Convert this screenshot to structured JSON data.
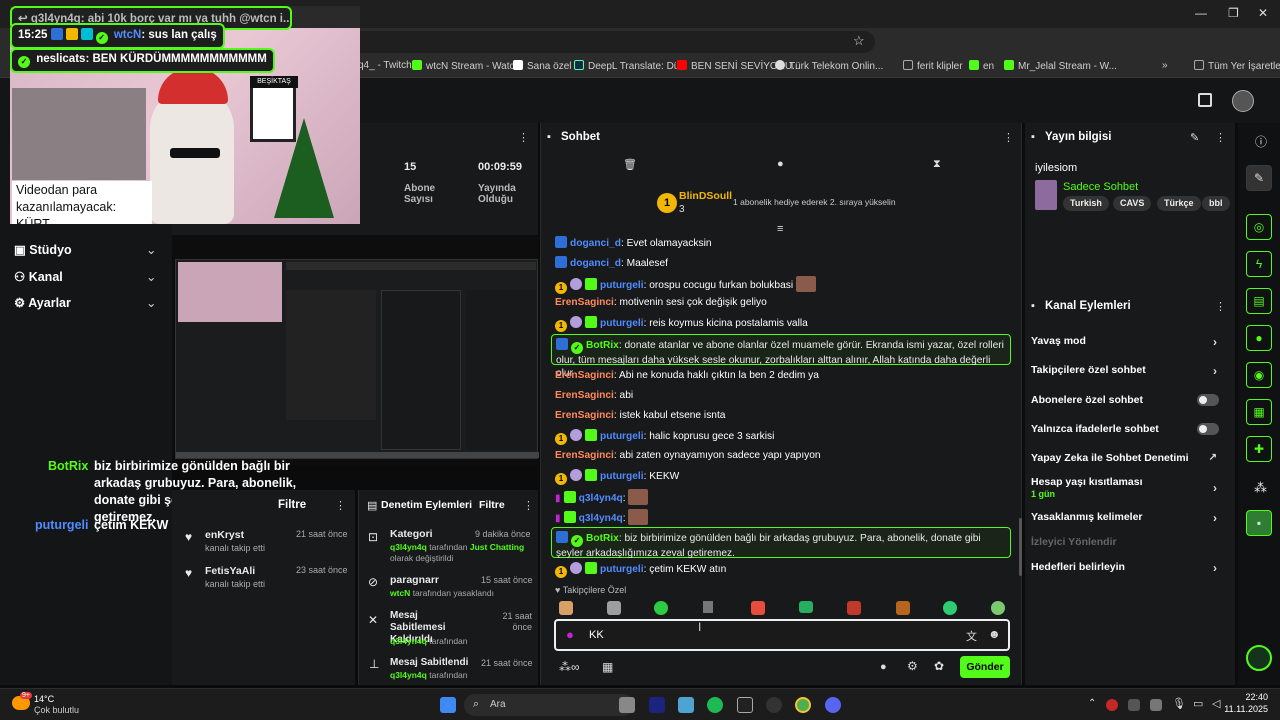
{
  "overlay": {
    "msg1_user": "q3l4yn4q",
    "msg1_text": ": abi 10k borç var mı ya tuhh @wtcn i...",
    "msg2_time": "15:25",
    "msg2_user": "wtcN",
    "msg2_text": ": sus lan çalış",
    "msg3_user": "neslicats",
    "msg3_text": ": BEN KÜRDÜMMMMMMMMMMM",
    "video_msg": "Videodan para kazanılamayacak: KÜRT",
    "flag_label": "BEŞİKTAŞ"
  },
  "browser": {
    "bookmarks": [
      {
        "label": "q4_ - Twitch",
        "color": "#9146ff"
      },
      {
        "label": "wtcN Stream - Watc...",
        "color": "#53fc18"
      },
      {
        "label": "Sana özel",
        "color": "#ffffff"
      },
      {
        "label": "DeepL Translate: Dü...",
        "color": "#0f2b46"
      },
      {
        "label": "BEN SENİ SEVİYORU...",
        "color": "#ff0000"
      },
      {
        "label": "Türk Telekom Onlin...",
        "color": "#ddd"
      },
      {
        "label": "ferit klipler",
        "color": "#aaa"
      },
      {
        "label": "en",
        "color": "#53fc18"
      },
      {
        "label": "Mr_Jelal Stream - W...",
        "color": "#53fc18"
      }
    ],
    "all_bookmarks": "Tüm Yer İşaretleri"
  },
  "leftnav": {
    "items": [
      {
        "label": "Stüdyo"
      },
      {
        "label": "Kanal"
      },
      {
        "label": "Ayarlar"
      }
    ]
  },
  "stats": {
    "viewers_value": "15",
    "viewers_label": "Abone Sayısı",
    "uptime_value": "00:09:59",
    "uptime_label": "Yayında Olduğu"
  },
  "stream_chat_overlay": {
    "bot_user": "BotRix",
    "bot_text": "biz birbirimize gönülden bağlı bir arkadaş grubuyuz. Para, abonelik, donate gibi şeyler arkadaşlığımıza zeval getiremez.",
    "user2": "puturgeli",
    "user2_text": "çetim KEKW atın"
  },
  "activity": {
    "title": "Filtre",
    "items": [
      {
        "name": "enKryst",
        "desc": "kanalı takip etti",
        "time": "21 saat önce"
      },
      {
        "name": "FetisYaAli",
        "desc": "kanalı takip etti",
        "time": "23 saat önce"
      }
    ]
  },
  "mod_actions": {
    "title": "Denetim Eylemleri",
    "filter": "Filtre",
    "items": [
      {
        "title": "Kategori",
        "line1": "q3l4yn4q",
        "line1b": "tarafından",
        "highlight": "Just Chatting",
        "line2": "olarak değiştirildi",
        "time": "9 dakika önce"
      },
      {
        "title": "paragnarr",
        "line1": "wtcN",
        "line1b": "tarafından yasaklandı",
        "highlight": "",
        "line2": "",
        "time": "15 saat önce"
      },
      {
        "title": "Mesaj Sabitlemesi Kaldırıldı",
        "line1": "q3l4yn4q",
        "line1b": "tarafından",
        "highlight": "",
        "line2": "",
        "time": "21 saat önce"
      },
      {
        "title": "Mesaj Sabitlendi",
        "line1": "q3l4yn4q",
        "line1b": "tarafından",
        "highlight": "",
        "line2": "",
        "time": "21 saat önce"
      }
    ]
  },
  "chat": {
    "title": "Sohbet",
    "gift_user": "BlinDSoull",
    "gift_rank": "3",
    "gift_text": "1 abonelik hediye ederek 2. sıraya yükselin",
    "messages": [
      {
        "user": "doganci_d",
        "text": ": Evet olamayacksin",
        "ucls": "u-blue"
      },
      {
        "user": "doganci_d",
        "text": ": Maalesef",
        "ucls": "u-blue"
      },
      {
        "user": "puturgeli",
        "text": ": orospu cocugu furkan bolukbasi",
        "ucls": "u-blue"
      },
      {
        "user": "ErenSaginci",
        "text": ": motivenin sesi çok değişik geliyo",
        "ucls": "u-orange"
      },
      {
        "user": "puturgeli",
        "text": ": reis koymus kicina postalamis valla",
        "ucls": "u-blue"
      },
      {
        "user": "ErenSaginci",
        "text": ": Abi ne konuda haklı çıktın la ben 2 dedim ya",
        "ucls": "u-orange"
      },
      {
        "user": "ErenSaginci",
        "text": ": abi",
        "ucls": "u-orange"
      },
      {
        "user": "ErenSaginci",
        "text": ": istek kabul etsene isnta",
        "ucls": "u-orange"
      },
      {
        "user": "puturgeli",
        "text": ": halic koprusu gece 3 sarkisi",
        "ucls": "u-blue"
      },
      {
        "user": "ErenSaginci",
        "text": ": abi zaten oynayamıyon sadece yapı yapıyon",
        "ucls": "u-orange"
      },
      {
        "user": "puturgeli",
        "text": ": KEKW",
        "ucls": "u-blue"
      },
      {
        "user": "q3l4yn4q",
        "text": ":",
        "ucls": "u-blue"
      },
      {
        "user": "q3l4yn4q",
        "text": ":",
        "ucls": "u-blue"
      },
      {
        "user": "puturgeli",
        "text": ": çetim KEKW atın",
        "ucls": "u-blue"
      }
    ],
    "bot1_user": "BotRix",
    "bot1_text": ": donate atanlar ve abone olanlar özel muamele görür. Ekranda ismi yazar, özel rolleri olur, tüm mesajları daha yüksek sesle okunur, zorbalıkları alttan alınır, Allah katında daha değerli olur",
    "bot2_user": "BotRix",
    "bot2_text": ": biz birbirimize gönülden bağlı bir arkadaş grubuyuz. Para, abonelik, donate gibi şeyler arkadaşlığımıza zeval getiremez.",
    "followers_only": "Takipçilere Özel",
    "input_value": "KK",
    "send_label": "Gönder"
  },
  "info": {
    "title": "Yayın bilgisi",
    "stream_title": "iyilesiom",
    "category": "Sadece Sohbet",
    "tags": [
      "Turkish",
      "CAVS",
      "Türkçe",
      "bbl"
    ]
  },
  "channel_actions": {
    "title": "Kanal Eylemleri",
    "items": [
      {
        "label": "Yavaş mod",
        "control": "chevron"
      },
      {
        "label": "Takipçilere özel sohbet",
        "control": "chevron"
      },
      {
        "label": "Abonelere özel sohbet",
        "control": "toggle"
      },
      {
        "label": "Yalnızca ifadelerle sohbet",
        "control": "toggle"
      },
      {
        "label": "Yapay Zeka ile Sohbet Denetimi",
        "control": "external"
      },
      {
        "label": "Hesap yaşı kısıtlaması",
        "control": "chevron"
      },
      {
        "label": "Yasaklanmış kelimeler",
        "control": "chevron"
      },
      {
        "label": "İzleyici Yönlendir",
        "control": "none"
      },
      {
        "label": "Hedefleri belirleyin",
        "control": "chevron"
      }
    ],
    "account_age_sub": "1 gün"
  },
  "taskbar": {
    "weather_temp": "14°C",
    "weather_desc": "Çok bulutlu",
    "search": "Ara",
    "time": "22:40",
    "date": "11.11.2025",
    "notif_count": "9+"
  }
}
